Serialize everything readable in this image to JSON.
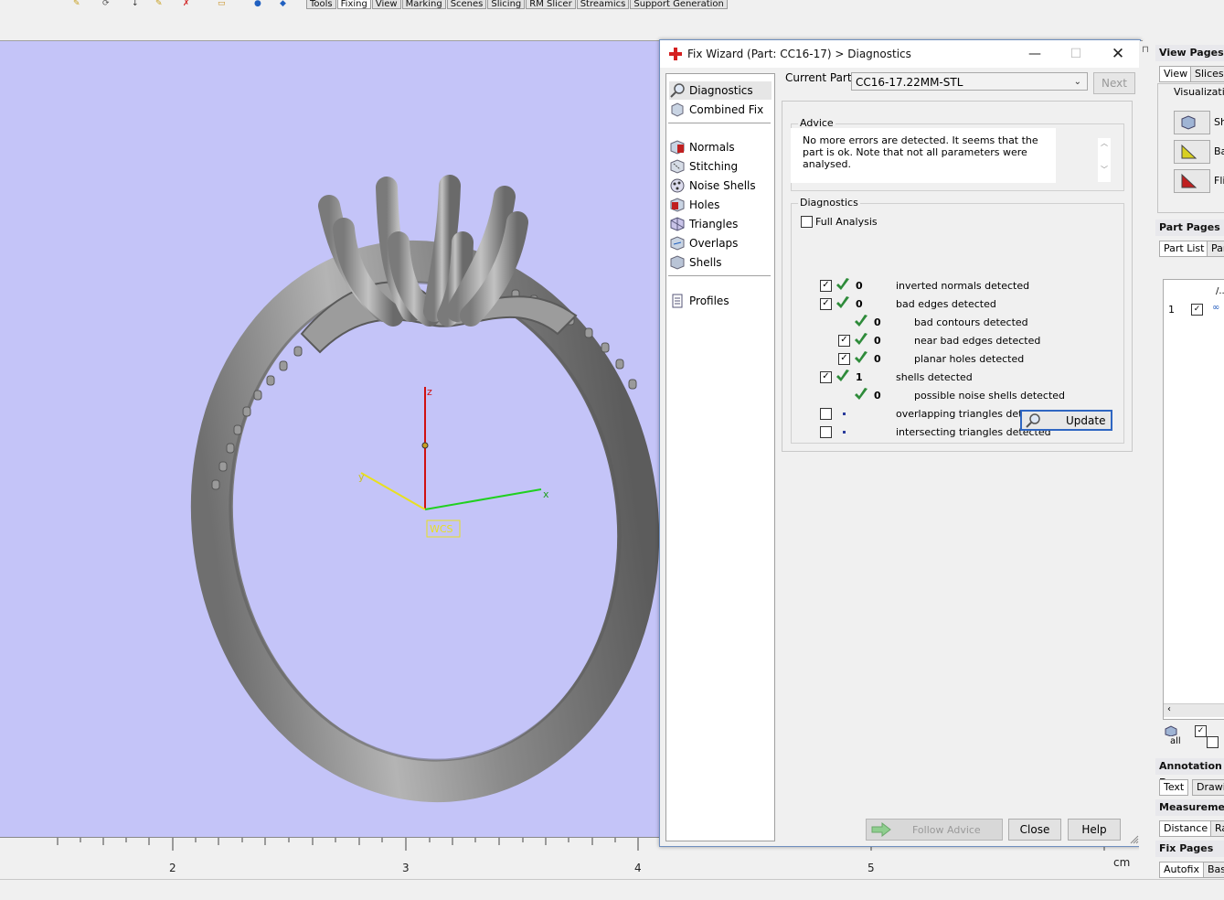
{
  "menu_tabs": [
    "Tools",
    "Fixing",
    "View",
    "Marking",
    "Scenes",
    "Slicing",
    "RM Slicer",
    "Streamics",
    "Support Generation"
  ],
  "active_menu_tab": "Fixing",
  "viewport": {
    "axis_z": "z",
    "axis_x": "x",
    "axis_y": "y",
    "wcs_label": "WCS",
    "ruler_labels": [
      "2",
      "3",
      "4",
      "5"
    ],
    "ruler_unit": "cm"
  },
  "wizard": {
    "title": "Fix Wizard (Part: CC16-17) > Diagnostics",
    "nav": {
      "top": [
        "Diagnostics",
        "Combined Fix"
      ],
      "tools": [
        "Normals",
        "Stitching",
        "Noise Shells",
        "Holes",
        "Triangles",
        "Overlaps",
        "Shells"
      ],
      "bottom": [
        "Profiles"
      ]
    },
    "current_part_label": "Current Part:",
    "current_part_value": "CC16-17.22MM-STL",
    "next_label": "Next",
    "advice_label": "Advice",
    "advice_text": "No more errors are detected. It seems that the part is ok. Note that not all parameters were analysed.",
    "diagnostics_label": "Diagnostics",
    "full_analysis_label": "Full Analysis",
    "rows": [
      {
        "label": "inverted normals detected",
        "count": "0",
        "checked": true,
        "status": "ok",
        "indent": 0
      },
      {
        "label": "bad edges detected",
        "count": "0",
        "checked": true,
        "status": "ok",
        "indent": 0
      },
      {
        "label": "bad contours detected",
        "count": "0",
        "checked": null,
        "status": "ok",
        "indent": 1
      },
      {
        "label": "near bad edges detected",
        "count": "0",
        "checked": true,
        "status": "ok",
        "indent": 1
      },
      {
        "label": "planar holes detected",
        "count": "0",
        "checked": true,
        "status": "ok",
        "indent": 1
      },
      {
        "label": "shells detected",
        "count": "1",
        "checked": true,
        "status": "ok",
        "indent": 0
      },
      {
        "label": "possible noise shells detected",
        "count": "0",
        "checked": null,
        "status": "ok",
        "indent": 1
      },
      {
        "label": "overlapping triangles detected",
        "count": "",
        "checked": false,
        "status": "none",
        "indent": 0
      },
      {
        "label": "intersecting triangles detected",
        "count": "",
        "checked": false,
        "status": "none",
        "indent": 0
      }
    ],
    "update_label": "Update",
    "follow_advice_label": "Follow Advice",
    "close_label": "Close",
    "help_label": "Help"
  },
  "right_panel": {
    "view_pages": "View Pages",
    "view_tabs": [
      "View",
      "Slices"
    ],
    "visualization": "Visualization",
    "vis_buttons": [
      "Sh",
      "Ba",
      "Fli"
    ],
    "part_pages": "Part Pages",
    "part_tabs": [
      "Part List",
      "Par"
    ],
    "row_number": "1",
    "all_label": "all",
    "annotation_pages": "Annotation P",
    "annotation_tabs": [
      "Text",
      "Drawin"
    ],
    "measurement": "Measuremen",
    "measurement_tabs": [
      "Distance",
      "Ra"
    ],
    "fix_pages": "Fix Pages",
    "fix_tabs": [
      "Autofix",
      "Bas"
    ]
  },
  "colors": {
    "viewport_bg": "#c4c4f8",
    "check_green": "#2e8b3a",
    "axis_z": "#d01010",
    "axis_x": "#20d020",
    "axis_y": "#e8e020"
  }
}
